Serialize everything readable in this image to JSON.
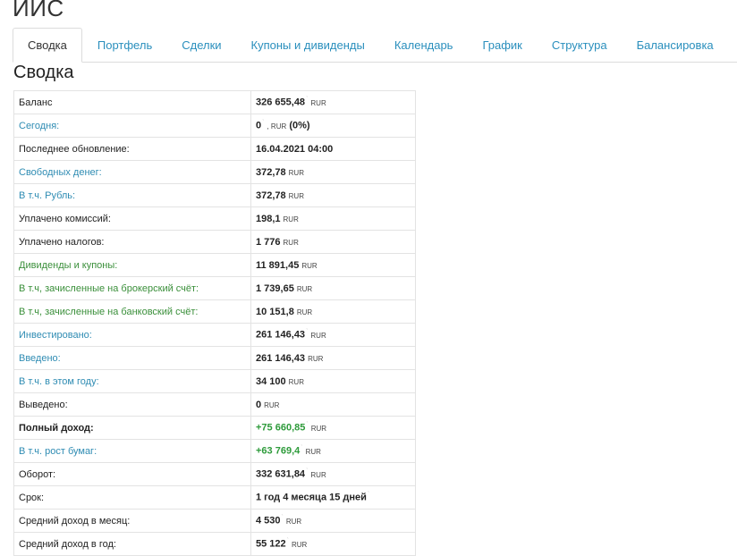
{
  "app": {
    "title": "ИИС"
  },
  "tabs": [
    {
      "label": "Сводка",
      "active": true
    },
    {
      "label": "Портфель"
    },
    {
      "label": "Сделки"
    },
    {
      "label": "Купоны и дивиденды"
    },
    {
      "label": "Календарь"
    },
    {
      "label": "График"
    },
    {
      "label": "Структура"
    },
    {
      "label": "Балансировка"
    }
  ],
  "section": {
    "title": "Сводка"
  },
  "rows": [
    {
      "label": "Баланс",
      "value": "326 655,48",
      "unit": "RUR",
      "tick": true
    },
    {
      "label": "Сегодня:",
      "value": "0",
      "unit": ", RUR",
      "extra": "(0%)",
      "tick": true
    },
    {
      "label": "Последнее обновление:",
      "value": "16.04.2021 04:00",
      "unit": ""
    },
    {
      "label": "Свободных денег:",
      "value": "372,78",
      "unit": "RUR"
    },
    {
      "label": "В т.ч. Рубль:",
      "value": "372,78",
      "unit": "RUR"
    },
    {
      "label": "Уплачено комиссий:",
      "value": "198,1",
      "unit": "RUR"
    },
    {
      "label": "Уплачено налогов:",
      "value": "1 776",
      "unit": "RUR"
    },
    {
      "label": "Дивиденды и купоны:",
      "value": "11 891,45",
      "unit": "RUR"
    },
    {
      "label": "В т.ч, зачисленные на брокерский счёт:",
      "value": "1 739,65",
      "unit": "RUR"
    },
    {
      "label": "В т.ч, зачисленные на банковский счёт:",
      "value": "10 151,8",
      "unit": "RUR"
    },
    {
      "label": "Инвестировано:",
      "value": "261 146,43",
      "unit": "RUR",
      "tick": true
    },
    {
      "label": "Введено:",
      "value": "261 146,43",
      "unit": "RUR"
    },
    {
      "label": "В т.ч. в этом году:",
      "value": "34 100",
      "unit": "RUR"
    },
    {
      "label": "Выведено:",
      "value": "0",
      "unit": "RUR"
    },
    {
      "label": "Полный доход:",
      "value": "+75 660,85",
      "unit": "RUR",
      "tick": true
    },
    {
      "label": "В т.ч. рост бумаг:",
      "value": "+63 769,4",
      "unit": "RUR",
      "tick": true
    },
    {
      "label": "Оборот:",
      "value": "332 631,84",
      "unit": "RUR",
      "tick": true
    },
    {
      "label": "Срок:",
      "value": "1 год 4 месяца 15 дней",
      "unit": "",
      "tick": true
    },
    {
      "label": "Средний доход в месяц:",
      "value": "4 530",
      "unit": "RUR",
      "tick": true
    },
    {
      "label": "Средний доход в год:",
      "value": "55 122",
      "unit": "RUR",
      "tick": true
    }
  ],
  "colors": {
    "link": "#2f8cb3",
    "dividend_label": "#3a8f3a",
    "positive_value": "#2e9b3b",
    "border": "#e3e3e3"
  },
  "icons": {
    "tick": "small-superscript-mark"
  }
}
